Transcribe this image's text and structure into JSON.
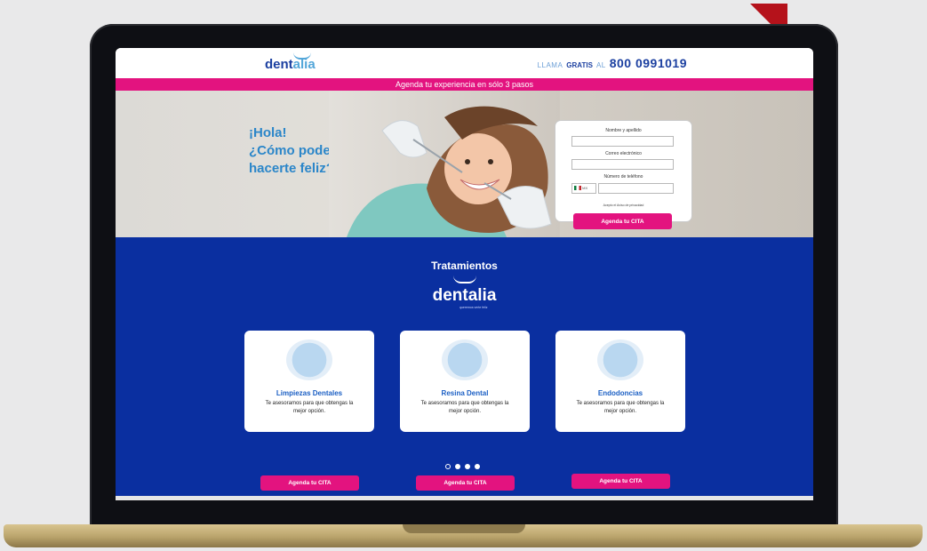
{
  "header": {
    "logo_main": "dent",
    "logo_accent": "alia",
    "call_pre": "LLAMA",
    "call_bold": "GRATIS",
    "call_al": "AL",
    "phone": "800 0991019"
  },
  "banner": {
    "text": "Agenda tu experiencia en sólo 3 pasos"
  },
  "hero": {
    "lines": [
      "¡Hola!",
      "¿Cómo podemos",
      "hacerte feliz?"
    ],
    "form": {
      "name_label": "Nombre y apellido",
      "email_label": "Correo electrónico",
      "phone_label": "Número de teléfono",
      "country_code": "MX",
      "privacy_text": "Acepto el Aviso de privacidad",
      "submit_label": "Agenda tu CITA"
    }
  },
  "treatments": {
    "title": "Tratamientos",
    "logo_text": "dentalia",
    "tagline": "queremos verte feliz",
    "cards": [
      {
        "title": "Limpiezas Dentales",
        "desc": "Te asesoramos para que obtengas la mejor opción.",
        "cta": "Agenda tu CITA"
      },
      {
        "title": "Resina Dental",
        "desc": "Te asesoramos para que obtengas la mejor opción.",
        "cta": "Agenda tu CITA"
      },
      {
        "title": "Endodoncias",
        "desc": "Te asesoramos para que obtengas la mejor opción.",
        "cta": "Agenda tu CITA"
      }
    ],
    "carousel": {
      "total": 4,
      "active": 1
    }
  },
  "colors": {
    "brand_blue": "#0a2fa0",
    "brand_pink": "#e3137f",
    "light_blue": "#53a6d9"
  },
  "icons": {
    "country_flag": "mexico-flag-icon",
    "card_image": "tooth-illustration-icon"
  }
}
